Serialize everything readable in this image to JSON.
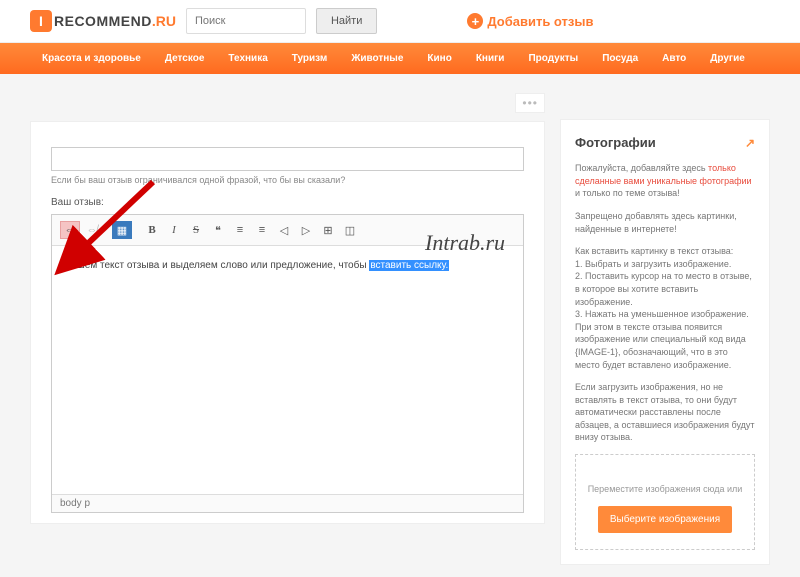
{
  "header": {
    "logo_text": "RECOMMEND",
    "logo_suffix": ".RU",
    "logo_badge": "I",
    "search_placeholder": "Поиск",
    "search_button": "Найти",
    "add_review": "Добавить отзыв"
  },
  "nav": {
    "items": [
      "Красота и здоровье",
      "Детское",
      "Техника",
      "Туризм",
      "Животные",
      "Кино",
      "Книги",
      "Продукты",
      "Посуда",
      "Авто",
      "Другие"
    ]
  },
  "editor": {
    "hint": "Если бы ваш отзыв ограничивался одной фразой, что бы вы сказали?",
    "label": "Ваш отзыв:",
    "body_text": "Пишем текст отзыва и выделяем слово или предложение, чтобы ",
    "body_selected": "вставить ссылку.",
    "status": "body  p"
  },
  "toolbar": {
    "b": "B",
    "i": "I",
    "s": "S",
    "quote": "❝",
    "ul": "≡",
    "ol": "≡",
    "out": "◁",
    "in": "▷",
    "table": "⊞",
    "src": "◫"
  },
  "sidebar": {
    "title": "Фотографии",
    "p1_a": "Пожалуйста, добавляйте здесь ",
    "p1_red": "только сделанные вами уникальные фотографии",
    "p1_b": " и только по теме отзыва!",
    "p2": "Запрещено добавлять здесь картинки, найденные в интернете!",
    "howto_title": "Как вставить картинку в текст отзыва:",
    "steps": [
      "1. Выбрать и загрузить изображение.",
      "2. Поставить курсор на то место в отзыве, в которое вы хотите вставить изображение.",
      "3. Нажать на уменьшенное изображение. При этом в тексте отзыва появится изображение или специальный код вида {IMAGE-1}, обозначающий, что в это место будет вставлено изображение."
    ],
    "p3": "Если загрузить изображения, но не вставлять в текст отзыва, то они будут автоматически расставлены после абзацев, а оставшиеся изображения будут внизу отзыва.",
    "dz_text": "Переместите изображения сюда или",
    "dz_button": "Выберите изображения"
  },
  "watermark": "Intrab.ru",
  "dots": "•••"
}
